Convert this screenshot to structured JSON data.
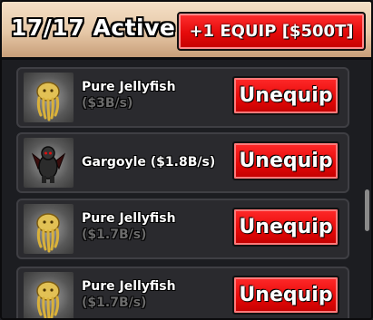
{
  "header": {
    "active_label": "17/17 Active",
    "equip_button": "+1 EQUIP [$500T]"
  },
  "items": [
    {
      "name": "Pure Jellyfish",
      "rate": "($3B/s)",
      "button": "Unequip",
      "icon": "jellyfish-icon"
    },
    {
      "name": "Gargoyle ($1.8B/s)",
      "rate": "",
      "button": "Unequip",
      "icon": "gargoyle-icon"
    },
    {
      "name": "Pure Jellyfish",
      "rate": "($1.7B/s)",
      "button": "Unequip",
      "icon": "jellyfish-icon"
    },
    {
      "name": "Pure Jellyfish",
      "rate": "($1.7B/s)",
      "button": "Unequip",
      "icon": "jellyfish-icon"
    }
  ],
  "colors": {
    "header_bg": "#e6c8a7",
    "button_red": "#e60808",
    "card_bg": "#2a2a2e",
    "rate_text": "#6b6b6b"
  }
}
